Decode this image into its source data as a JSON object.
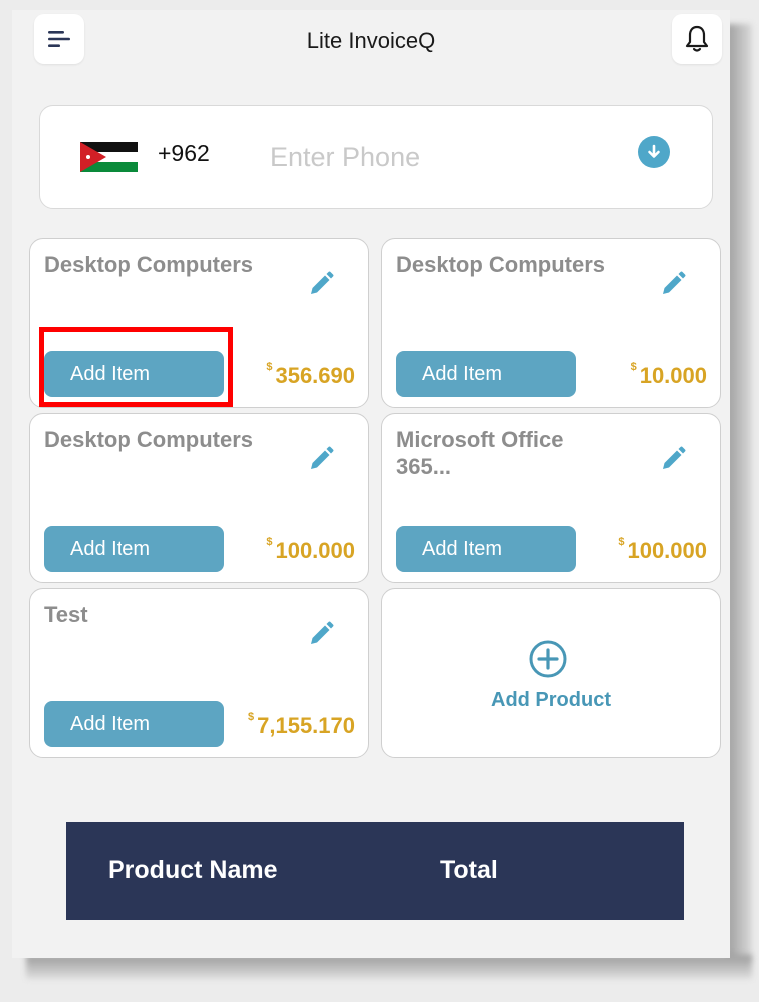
{
  "app": {
    "title": "Lite InvoiceQ"
  },
  "phone": {
    "dial_code": "+962",
    "placeholder": "Enter Phone",
    "country_flag": "jordan-flag-icon"
  },
  "products": [
    {
      "name": "Desktop Computers",
      "add_label": "Add Item",
      "currency": "$",
      "price": "356.690"
    },
    {
      "name": "Desktop Computers",
      "add_label": "Add Item",
      "currency": "$",
      "price": "10.000"
    },
    {
      "name": "Desktop Computers",
      "add_label": "Add Item",
      "currency": "$",
      "price": "100.000"
    },
    {
      "name": "Microsoft Office 365...",
      "add_label": "Add Item",
      "currency": "$",
      "price": "100.000"
    },
    {
      "name": "Test",
      "add_label": "Add Item",
      "currency": "$",
      "price": "7,155.170"
    }
  ],
  "add_product": {
    "label": "Add Product"
  },
  "table": {
    "col_product": "Product Name",
    "col_total": "Total"
  },
  "colors": {
    "accent": "#5da5c2",
    "price": "#d8a424",
    "table_header_bg": "#2b3657",
    "highlight": "#ff0000"
  }
}
